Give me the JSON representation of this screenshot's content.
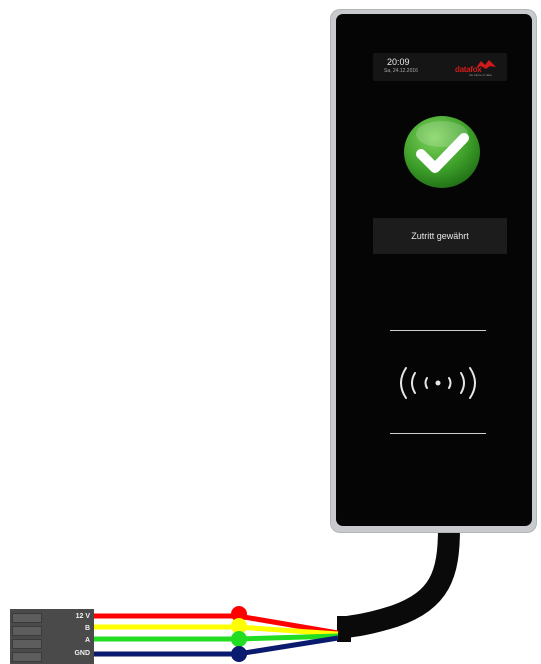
{
  "device": {
    "time": "20:09",
    "date": "Sa, 24.12.2016",
    "logo_text": "datafox",
    "logo_subtext": "the future of data",
    "message": "Zutritt gewährt",
    "status_icon": "check-icon",
    "reader_icon": "rfid-icon"
  },
  "connector": {
    "pins": [
      {
        "label": "12 V",
        "color": "#ff0000"
      },
      {
        "label": "B",
        "color": "#ffff00"
      },
      {
        "label": "A",
        "color": "#22dd22"
      },
      {
        "label": "GND",
        "color": "#0a1a6e"
      }
    ]
  },
  "colors": {
    "housing": "#c9cacd",
    "screen": "#050505",
    "check_green": "#3ea02a",
    "cable": "#0a0a0a"
  }
}
